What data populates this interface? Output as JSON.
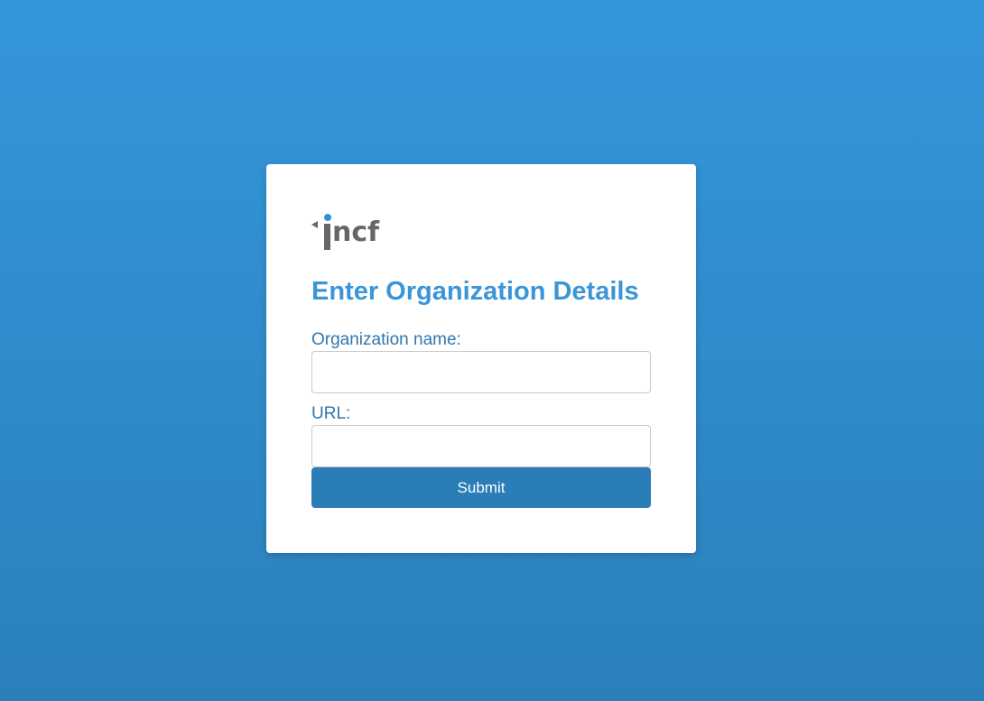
{
  "logo": {
    "text": "incf",
    "icon": "incf-logo",
    "text_color": "#666666",
    "accent_color": "#2e93d1"
  },
  "form": {
    "title": "Enter Organization Details",
    "org_name_label": "Organization name:",
    "org_name_value": "",
    "url_label": "URL:",
    "url_value": "",
    "submit_label": "Submit"
  },
  "colors": {
    "background_top": "#3497db",
    "background_bottom": "#2b80bb",
    "title": "#3a96d6",
    "label": "#3177ad",
    "button": "#2a7db7"
  }
}
